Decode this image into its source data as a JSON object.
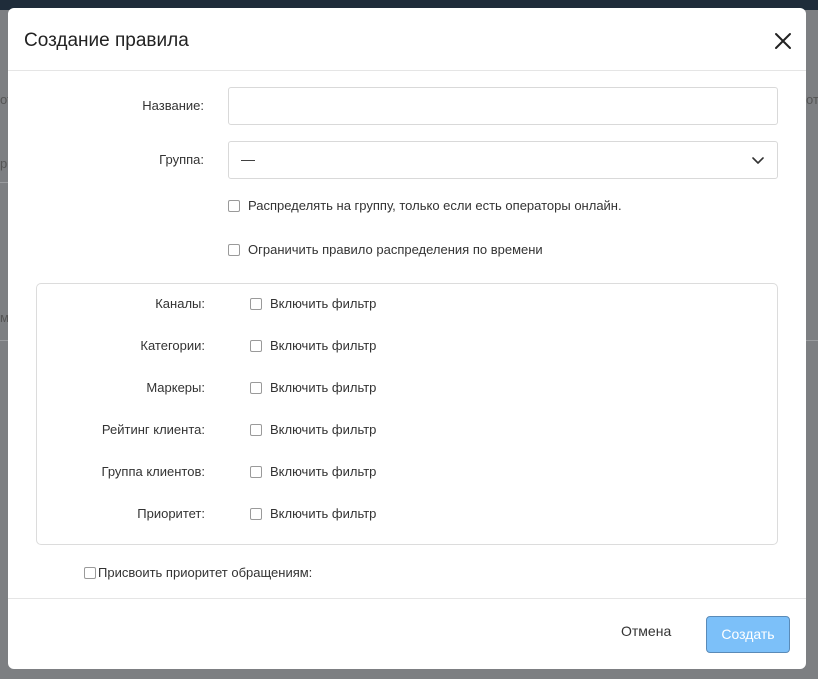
{
  "background": {
    "fragments": [
      "ото",
      "р",
      "м",
      "ото"
    ]
  },
  "dialog": {
    "title": "Создание правила"
  },
  "form": {
    "name_label": "Название:",
    "name_value": "",
    "group_label": "Группа:",
    "group_value": "—",
    "distribute_online_label": "Распределять на группу, только если есть операторы онлайн.",
    "limit_time_label": "Ограничить правило распределения по времени"
  },
  "filters": [
    {
      "label": "Каналы:",
      "toggle": "Включить фильтр"
    },
    {
      "label": "Категории:",
      "toggle": "Включить фильтр"
    },
    {
      "label": "Маркеры:",
      "toggle": "Включить фильтр"
    },
    {
      "label": "Рейтинг клиента:",
      "toggle": "Включить фильтр"
    },
    {
      "label": "Группа клиентов:",
      "toggle": "Включить фильтр"
    },
    {
      "label": "Приоритет:",
      "toggle": "Включить фильтр"
    }
  ],
  "assign_priority_label": "Присвоить приоритет обращениям:",
  "footer": {
    "cancel_label": "Отмена",
    "create_label": "Создать"
  },
  "colors": {
    "create_button": "#7cc0f9",
    "overlay": "#7d7f82",
    "top_bar": "#1f2c3a"
  },
  "icons": {
    "close": "close-icon",
    "dropdown": "chevron-down-icon"
  }
}
